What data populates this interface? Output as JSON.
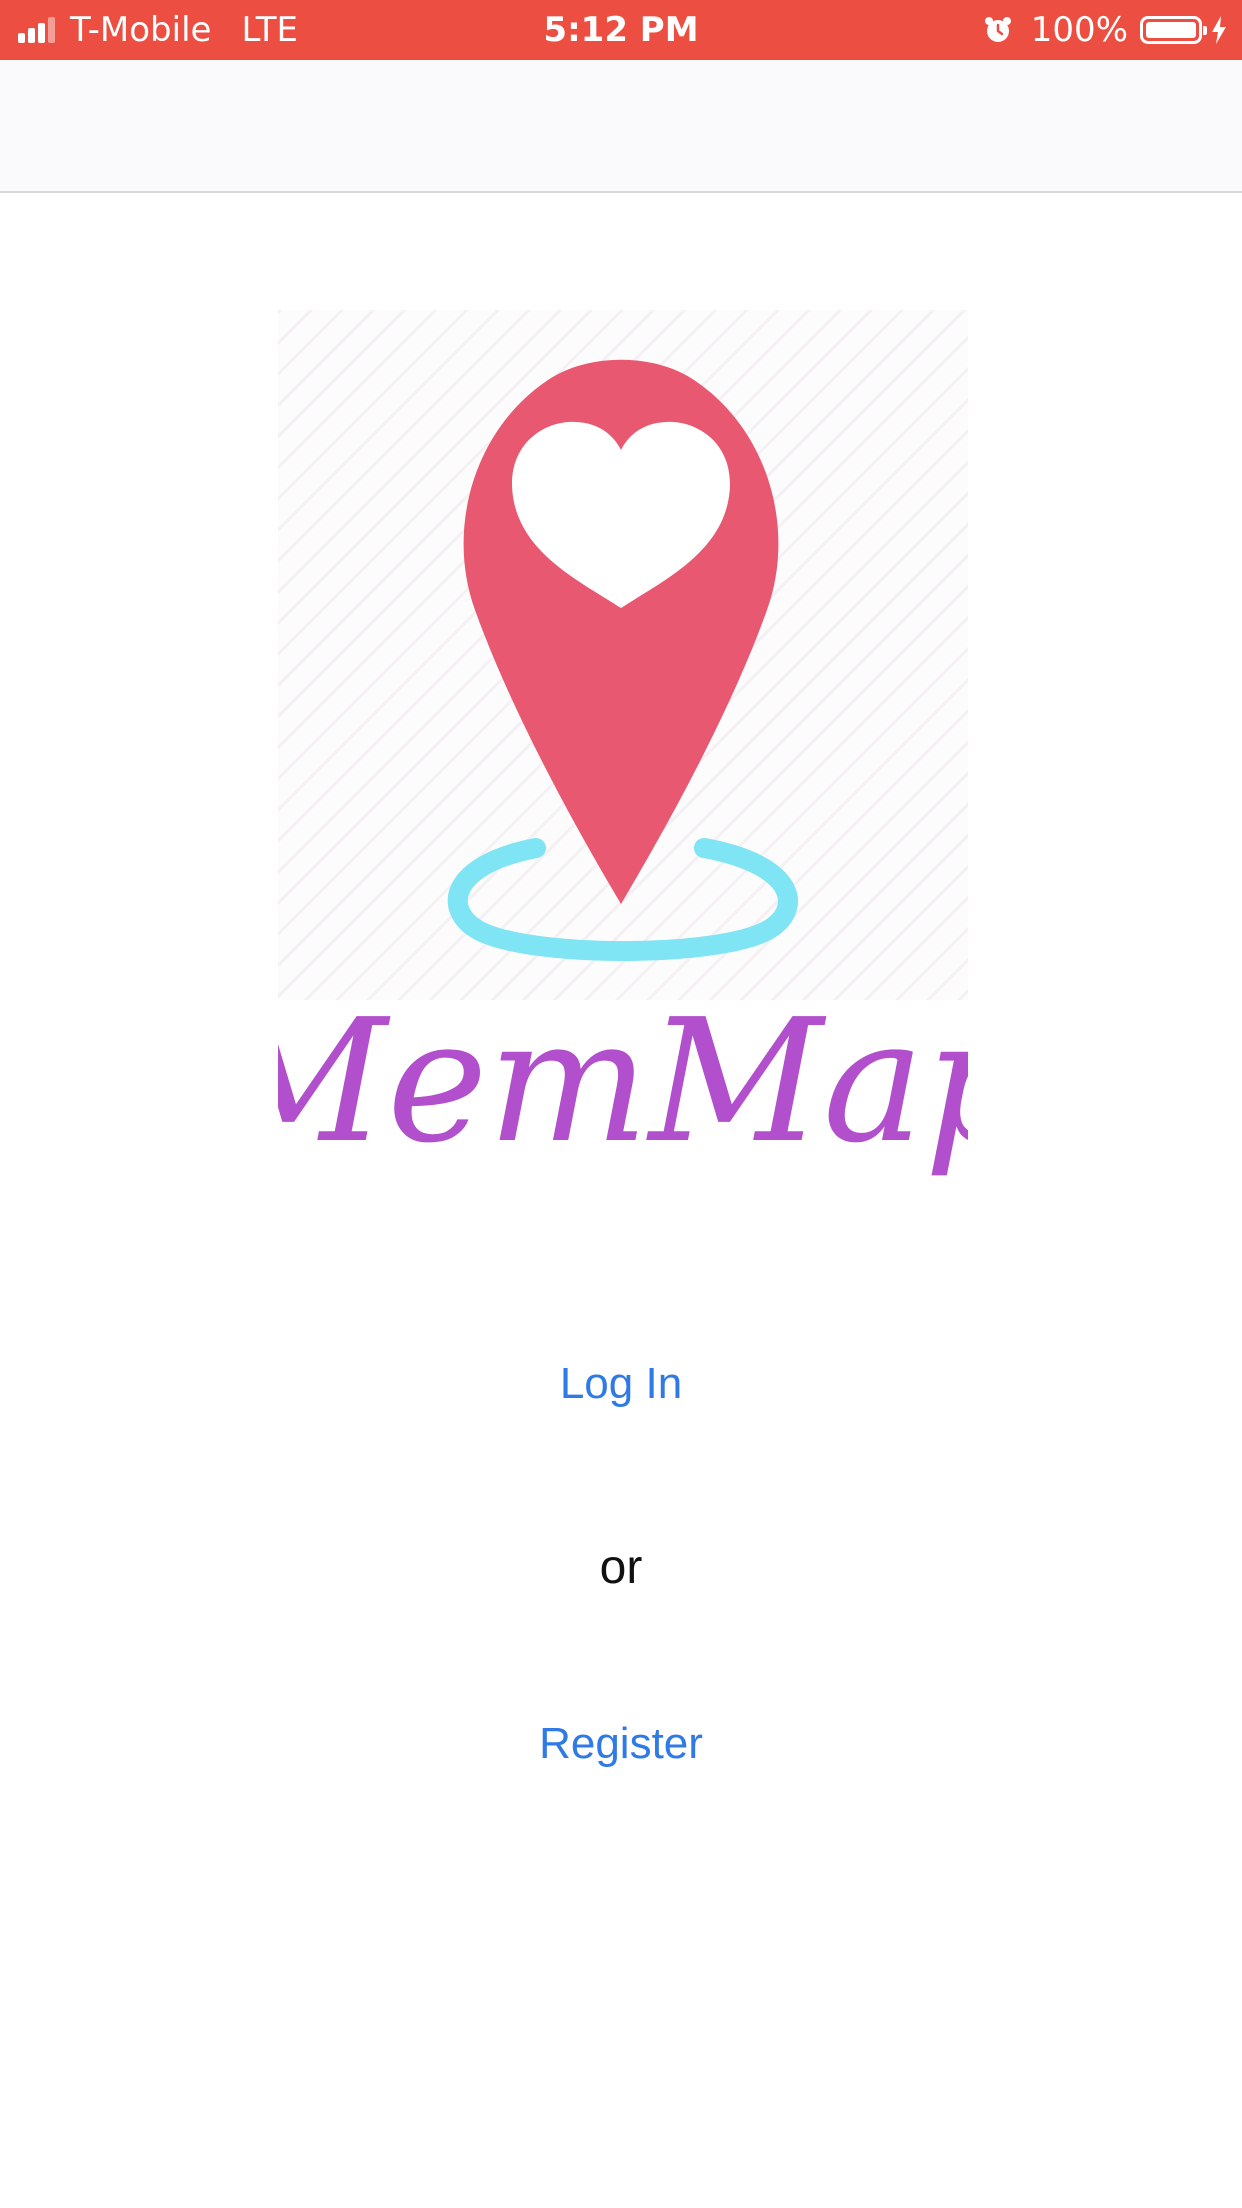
{
  "status_bar": {
    "carrier": "T-Mobile",
    "network": "LTE",
    "time": "5:12 PM",
    "battery_percent": "100%",
    "background_color": "#ec4e41",
    "icons": [
      "signal-icon",
      "alarm-icon",
      "battery-icon",
      "charging-bolt-icon"
    ]
  },
  "logo": {
    "text": "MemMap",
    "pin_color": "#e95871",
    "ring_color": "#7fe4f3",
    "text_color": "#b14fcc",
    "icons": [
      "map-pin-heart-icon"
    ]
  },
  "actions": {
    "login_label": "Log In",
    "separator": "or",
    "register_label": "Register",
    "link_color": "#2f7ae4"
  }
}
